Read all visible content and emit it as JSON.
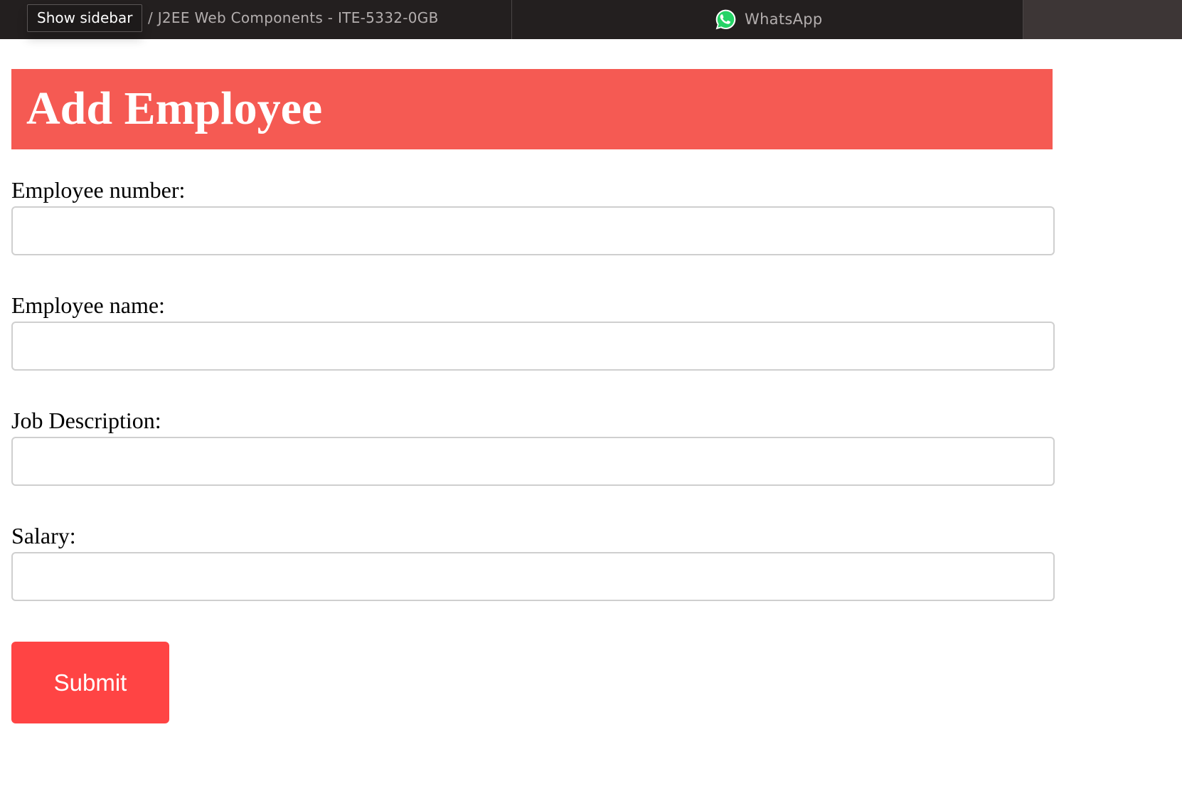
{
  "browser": {
    "tooltip": "Show sidebar",
    "tab_left_title": "/ J2EE Web Components - ITE-5332-0GB",
    "tab_middle": {
      "icon": "whatsapp-icon",
      "title": "WhatsApp"
    }
  },
  "page": {
    "heading": "Add Employee",
    "fields": [
      {
        "label": "Employee number:",
        "value": "",
        "placeholder": ""
      },
      {
        "label": "Employee name:",
        "value": "",
        "placeholder": ""
      },
      {
        "label": "Job Description:",
        "value": "",
        "placeholder": ""
      },
      {
        "label": "Salary:",
        "value": "",
        "placeholder": ""
      }
    ],
    "submit_label": "Submit"
  },
  "colors": {
    "tabbar_bg": "#231f1f",
    "header_bg": "#f55a53",
    "submit_bg": "#ff4444",
    "whatsapp_green": "#25d366"
  }
}
